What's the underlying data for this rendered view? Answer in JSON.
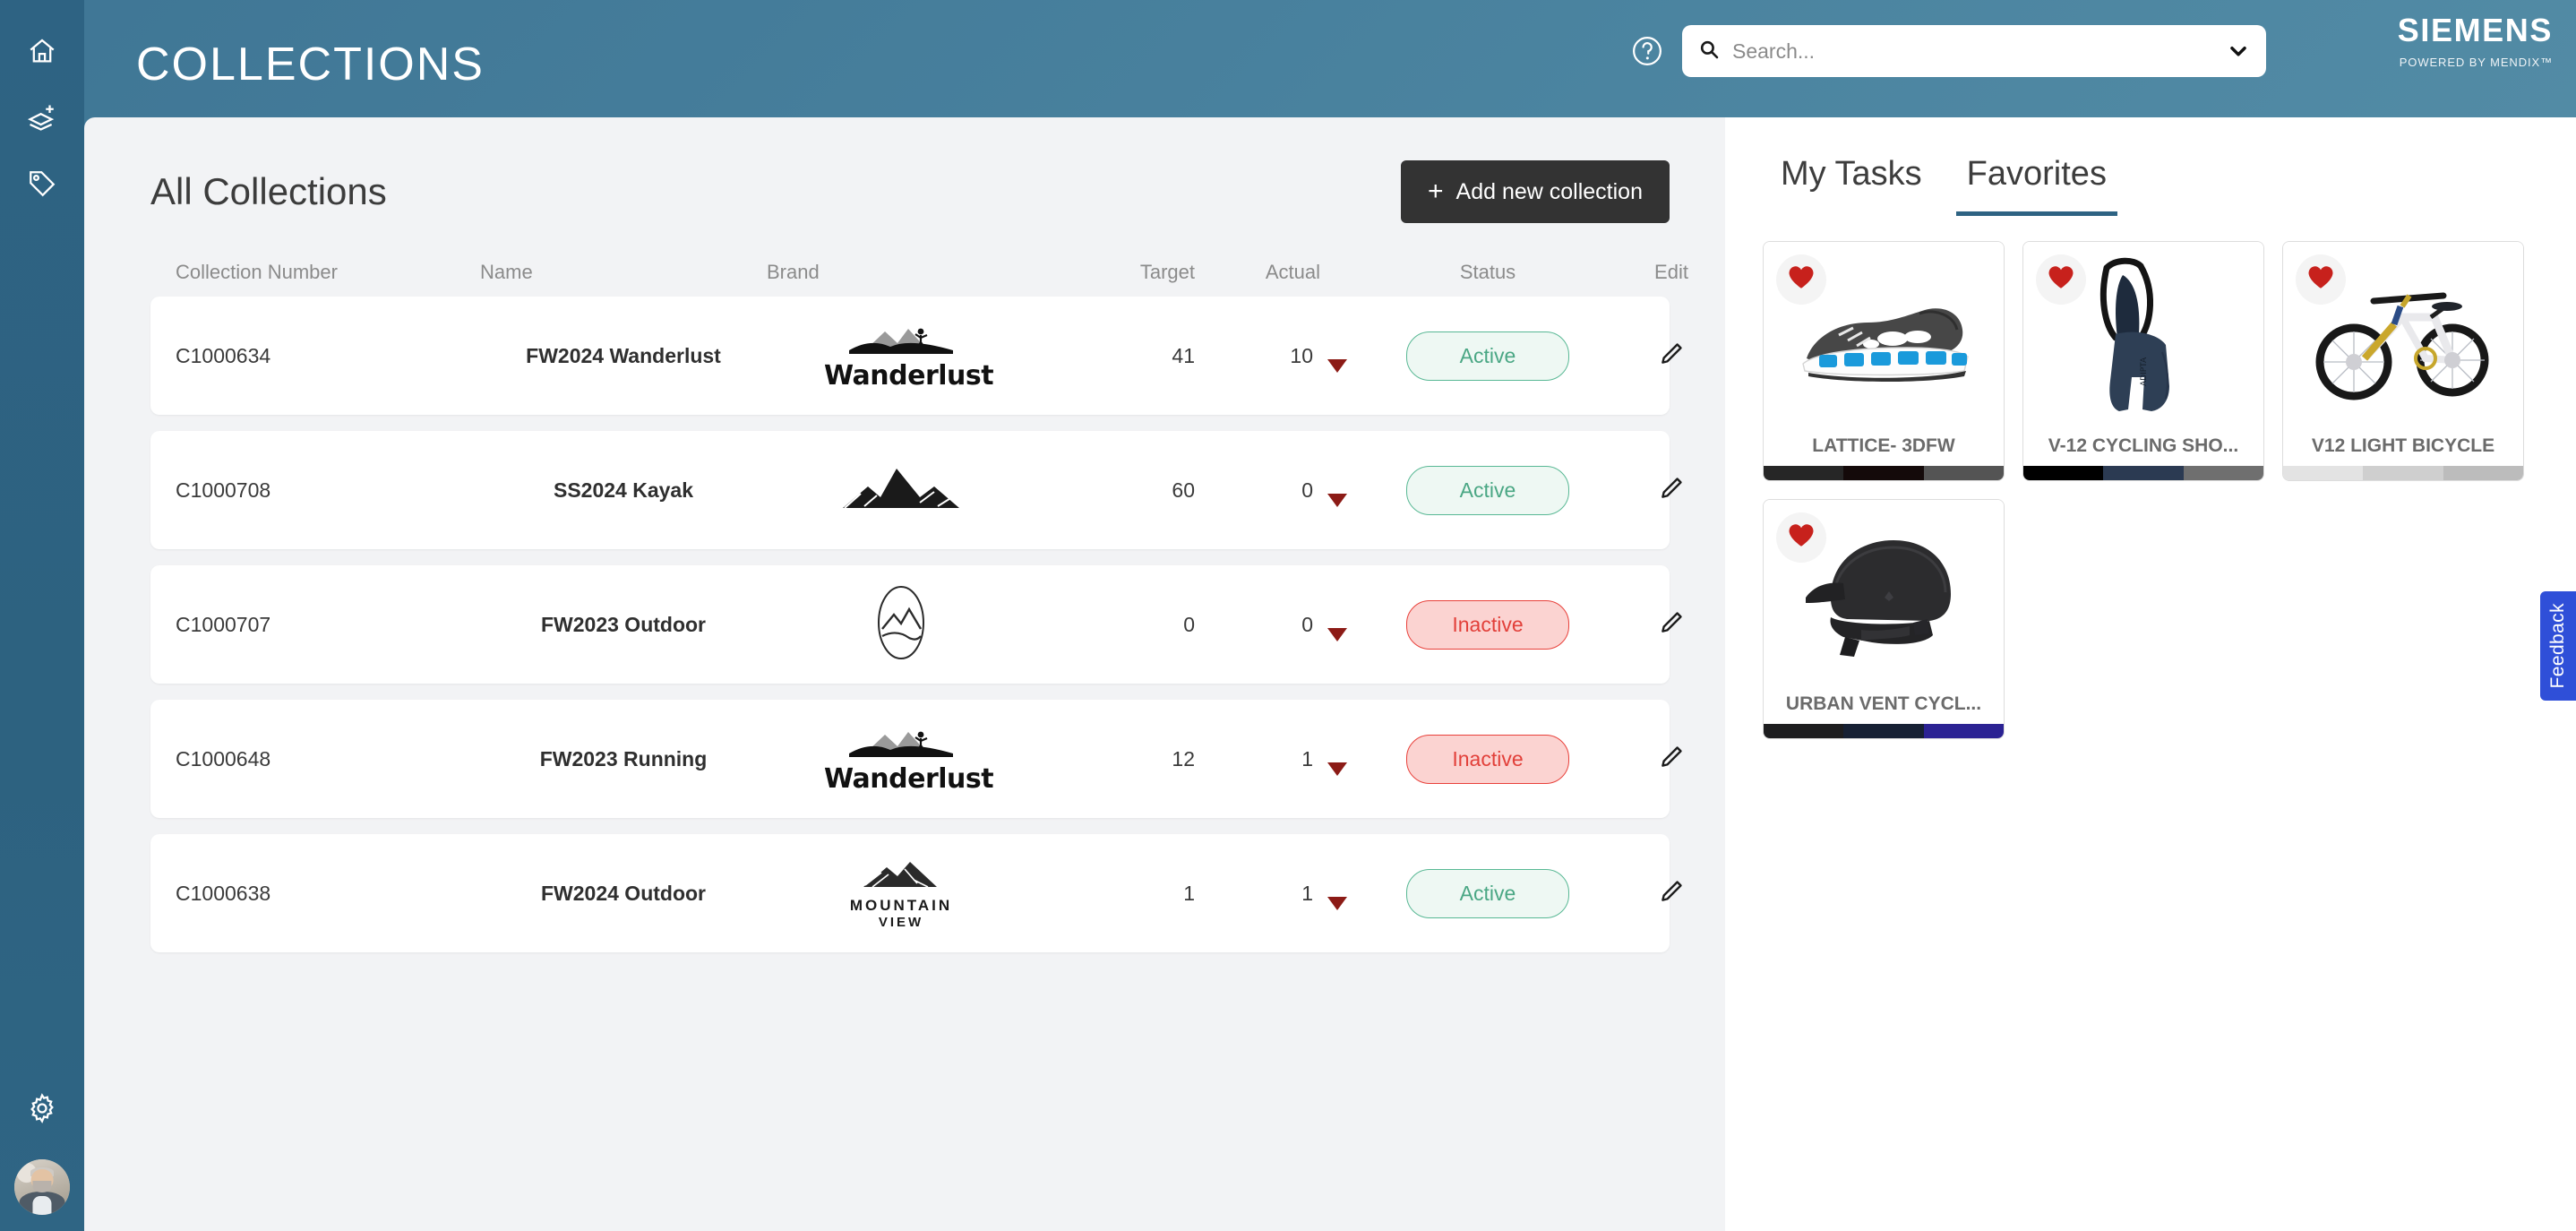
{
  "header": {
    "page_title": "COLLECTIONS",
    "help_icon": "help-circle-icon",
    "brand": "SIEMENS",
    "powered_by": "POWERED BY MENDIX™"
  },
  "search": {
    "placeholder": "Search...",
    "value": "",
    "search_icon": "search-icon",
    "dropdown_icon": "chevron-down-icon"
  },
  "sidebar": {
    "items": [
      {
        "icon": "home-icon",
        "name": "home"
      },
      {
        "icon": "layers-plus-icon",
        "name": "add-collection"
      },
      {
        "icon": "tag-icon",
        "name": "tags"
      }
    ],
    "bottom": [
      {
        "icon": "gear-icon",
        "name": "settings"
      },
      {
        "icon": "avatar",
        "name": "user-profile"
      }
    ]
  },
  "main": {
    "title": "All Collections",
    "add_button": {
      "label": "Add new collection",
      "plus": "+"
    },
    "columns": [
      "Collection Number",
      "Name",
      "Brand",
      "Target",
      "Actual",
      "Status",
      "Edit"
    ],
    "rows": [
      {
        "collection_number": "C1000634",
        "name": "FW2024 Wanderlust",
        "brand": "Wanderlust",
        "brand_logo": "wanderlust-logo",
        "target": "41",
        "actual": "10",
        "trend": "down",
        "status": "Active",
        "edit_icon": "pencil-icon"
      },
      {
        "collection_number": "C1000708",
        "name": "SS2024 Kayak",
        "brand": "Mountain Peaks",
        "brand_logo": "mountain-peaks-logo",
        "target": "60",
        "actual": "0",
        "trend": "down",
        "status": "Active",
        "edit_icon": "pencil-icon"
      },
      {
        "collection_number": "C1000707",
        "name": "FW2023 Outdoor",
        "brand": "Oval Mountain",
        "brand_logo": "oval-mountain-logo",
        "target": "0",
        "actual": "0",
        "trend": "down",
        "status": "Inactive",
        "edit_icon": "pencil-icon"
      },
      {
        "collection_number": "C1000648",
        "name": "FW2023 Running",
        "brand": "Wanderlust",
        "brand_logo": "wanderlust-logo",
        "target": "12",
        "actual": "1",
        "trend": "down",
        "status": "Inactive",
        "edit_icon": "pencil-icon"
      },
      {
        "collection_number": "C1000638",
        "name": "FW2024 Outdoor",
        "brand": "Mountain View",
        "brand_logo": "mountain-view-logo",
        "brand_line1": "MOUNTAIN",
        "brand_line2": "VIEW",
        "target": "1",
        "actual": "1",
        "trend": "down",
        "status": "Active",
        "edit_icon": "pencil-icon"
      }
    ]
  },
  "right_panel": {
    "tabs": [
      {
        "label": "My Tasks",
        "selected": false
      },
      {
        "label": "Favorites",
        "selected": true
      }
    ],
    "cards": [
      {
        "title": "LATTICE- 3DFW",
        "image": "running-shoe",
        "favorite": true,
        "heart_icon": "heart-icon",
        "swatches": [
          "#262626",
          "#140a0a",
          "#545454"
        ]
      },
      {
        "title": "V-12 CYCLING SHO...",
        "image": "cycling-bib-shorts",
        "favorite": true,
        "heart_icon": "heart-icon",
        "swatches": [
          "#000000",
          "#2b3a52",
          "#6f6f6f"
        ]
      },
      {
        "title": "V12 LIGHT BICYCLE",
        "image": "mountain-bicycle",
        "favorite": true,
        "heart_icon": "heart-icon",
        "swatches": [
          "#e3e3e3",
          "#cfcfcf",
          "#bcbcbc"
        ]
      },
      {
        "title": "URBAN VENT CYCL...",
        "image": "cycling-helmet",
        "favorite": true,
        "heart_icon": "heart-icon",
        "swatches": [
          "#1d1d1f",
          "#162033",
          "#2b2293"
        ]
      }
    ]
  },
  "feedback": {
    "label": "Feedback"
  },
  "colors": {
    "header_blue": "#4b84a0",
    "sidebar_blue": "#2e6383",
    "panel_bg": "#f2f3f5",
    "accent_tab": "#2e6383",
    "active_green": "#4aa784",
    "inactive_red": "#e2403a",
    "trend_down": "#8c1b16",
    "feedback_blue": "#2f4fd8",
    "heart_red": "#c7211c"
  }
}
